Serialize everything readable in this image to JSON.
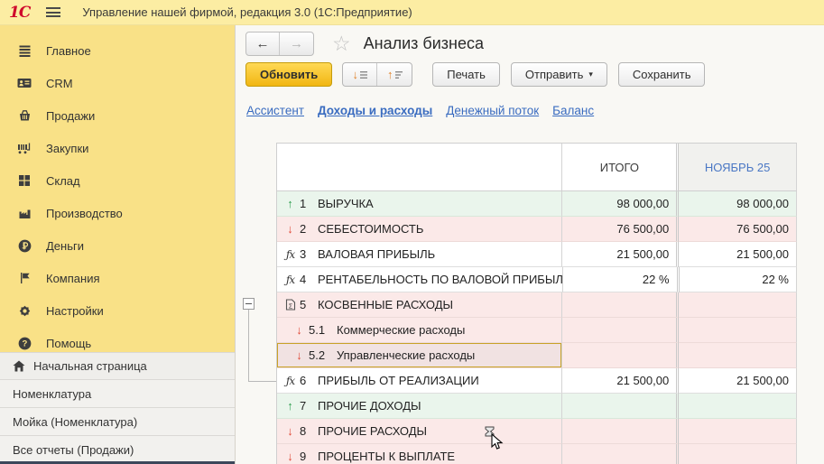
{
  "topbar": {
    "logo": "1С",
    "title": "Управление нашей фирмой, редакция 3.0  (1С:Предприятие)"
  },
  "sidebar": {
    "menu": [
      {
        "label": "Главное",
        "icon": "menu-lines-icon"
      },
      {
        "label": "CRM",
        "icon": "contact-card-icon"
      },
      {
        "label": "Продажи",
        "icon": "basket-icon"
      },
      {
        "label": "Закупки",
        "icon": "cart-icon"
      },
      {
        "label": "Склад",
        "icon": "grid-icon"
      },
      {
        "label": "Производство",
        "icon": "factory-icon"
      },
      {
        "label": "Деньги",
        "icon": "ruble-coin-icon"
      },
      {
        "label": "Компания",
        "icon": "flag-icon"
      },
      {
        "label": "Настройки",
        "icon": "gear-icon"
      },
      {
        "label": "Помощь",
        "icon": "help-icon"
      }
    ],
    "windows": [
      {
        "label": "Начальная страница",
        "icon": "home-icon"
      },
      {
        "label": "Номенклатура"
      },
      {
        "label": "Мойка (Номенклатура)"
      },
      {
        "label": "Все отчеты (Продажи)"
      }
    ]
  },
  "header": {
    "title": "Анализ бизнеса"
  },
  "toolbar": {
    "refresh": "Обновить",
    "print": "Печать",
    "send": "Отправить",
    "save": "Сохранить"
  },
  "tabs": [
    {
      "label": "Ассистент",
      "active": false
    },
    {
      "label": "Доходы и расходы",
      "active": true
    },
    {
      "label": "Денежный поток",
      "active": false
    },
    {
      "label": "Баланс",
      "active": false
    }
  ],
  "table": {
    "columns": {
      "total": "ИТОГО",
      "period": "НОЯБРЬ 25"
    },
    "rows": [
      {
        "num": "1",
        "label": "ВЫРУЧКА",
        "total": "98 000,00",
        "period": "98 000,00",
        "trend": "up",
        "tone": "green"
      },
      {
        "num": "2",
        "label": "СЕБЕСТОИМОСТЬ",
        "total": "76 500,00",
        "period": "76 500,00",
        "trend": "down",
        "tone": "pink"
      },
      {
        "num": "3",
        "label": "ВАЛОВАЯ ПРИБЫЛЬ",
        "total": "21 500,00",
        "period": "21 500,00",
        "trend": "formula",
        "tone": "white"
      },
      {
        "num": "4",
        "label": "РЕНТАБЕЛЬНОСТЬ ПО ВАЛОВОЙ ПРИБЫЛИ",
        "total": "22 %",
        "period": "22 %",
        "trend": "formula",
        "tone": "white"
      },
      {
        "num": "5",
        "label": "КОСВЕННЫЕ РАСХОДЫ",
        "total": "",
        "period": "",
        "trend": "group",
        "tone": "pink"
      },
      {
        "num": "5.1",
        "label": "Коммерческие расходы",
        "total": "",
        "period": "",
        "trend": "down",
        "tone": "pink",
        "sub": true
      },
      {
        "num": "5.2",
        "label": "Управленческие расходы",
        "total": "",
        "period": "",
        "trend": "down",
        "tone": "pink",
        "sub": true,
        "selected": true
      },
      {
        "num": "6",
        "label": "ПРИБЫЛЬ ОТ РЕАЛИЗАЦИИ",
        "total": "21 500,00",
        "period": "21 500,00",
        "trend": "formula",
        "tone": "white"
      },
      {
        "num": "7",
        "label": "ПРОЧИЕ ДОХОДЫ",
        "total": "",
        "period": "",
        "trend": "up",
        "tone": "green"
      },
      {
        "num": "8",
        "label": "ПРОЧИЕ РАСХОДЫ",
        "total": "",
        "period": "",
        "trend": "down",
        "tone": "pink"
      },
      {
        "num": "9",
        "label": "ПРОЦЕНТЫ К ВЫПЛАТЕ",
        "total": "",
        "period": "",
        "trend": "down",
        "tone": "pink"
      }
    ]
  },
  "colors": {
    "topbar_yellow": "#fceda3",
    "sidebar_yellow": "#f9e187",
    "accent_button_yellow": "#f1b612",
    "row_green": "#eaf5ec",
    "row_pink": "#fbe9e8",
    "selection_border": "#c9a227",
    "link_blue": "#3a6cc0",
    "trend_up_green": "#2f9e50",
    "trend_down_red": "#e04b3a"
  }
}
